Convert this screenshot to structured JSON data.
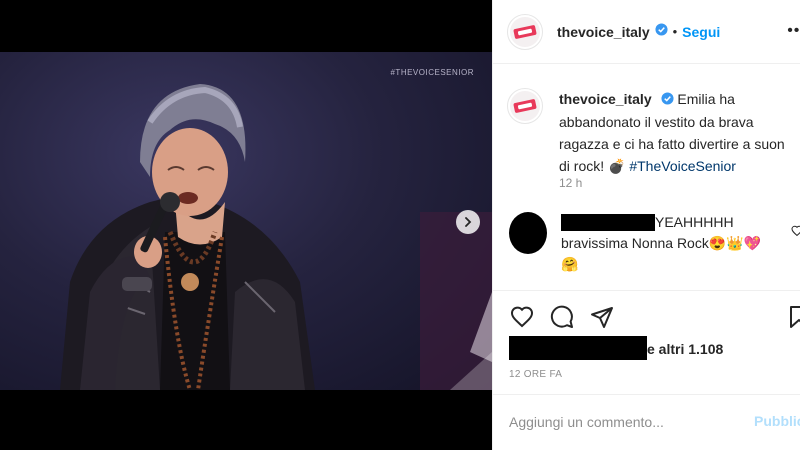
{
  "media": {
    "watermark": "#THEVOICESENIOR",
    "next_icon": "chevron-right-icon"
  },
  "header": {
    "username": "thevoice_italy",
    "dot": "•",
    "follow_label": "Segui",
    "more_icon": "more-horizontal-icon"
  },
  "caption": {
    "username": "thevoice_italy",
    "text": "Emilia ha abbandonato il vestito da brava ragazza e ci ha fatto divertire a suon di rock!",
    "emoji": "💣",
    "hashtag": "#TheVoiceSenior",
    "time": "12 h"
  },
  "comment": {
    "text": "YEAHHHHH bravissima Nonna Rock",
    "emojis": "😍👑💖",
    "emoji2": "🤗"
  },
  "likes": {
    "text": "e altri 1.108"
  },
  "date_label": "12 ORE FA",
  "add_comment": {
    "placeholder": "Aggiungi un commento...",
    "publish_label": "Pubblica"
  },
  "colors": {
    "link": "#0095f6",
    "hashtag": "#00376b",
    "muted": "#8e8e8e",
    "publish_disabled": "#b2dffc"
  }
}
